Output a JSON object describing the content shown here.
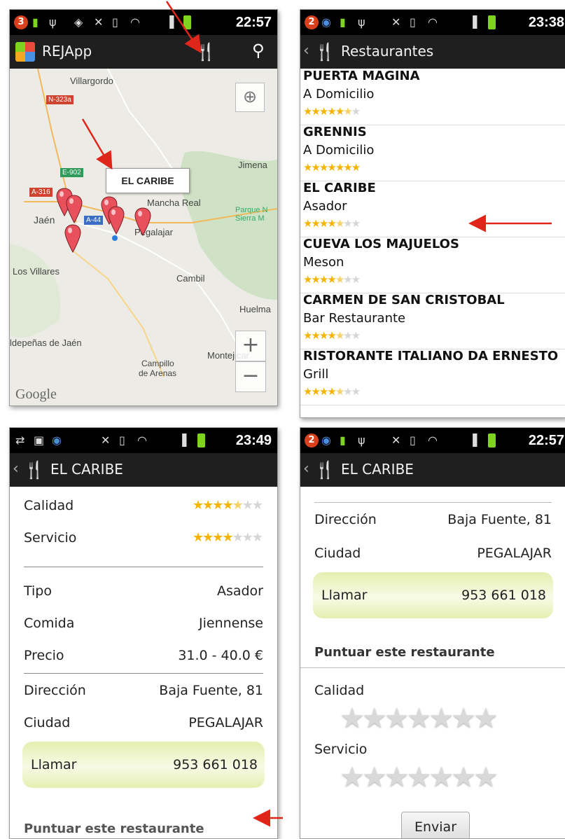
{
  "screen1": {
    "status_badge": "3",
    "time": "22:57",
    "app_title": "REJApp",
    "map": {
      "places": [
        "Villargordo",
        "Jimena",
        "Jaén",
        "Mancha Real",
        "Pegalajar",
        "Parque N",
        "Sierra M",
        "Los Villares",
        "Cambil",
        "Huelma",
        "ldepeñas de Jaén",
        "Campillo",
        "de Arenas",
        "Montejicar"
      ],
      "roads": [
        "N-323a",
        "E-902",
        "A-316",
        "A-44"
      ],
      "callout": "EL CARIBE",
      "attribution": "Google",
      "zoom_in": "+",
      "zoom_out": "−"
    }
  },
  "screen2": {
    "status_badge": "2",
    "time": "23:38",
    "title": "Restaurantes",
    "restaurants": [
      {
        "name": "PUERTA MAGINA",
        "type": "A Domicilio",
        "rating": 5.5
      },
      {
        "name": "GRENNIS",
        "type": "A Domicilio",
        "rating": 7
      },
      {
        "name": "EL CARIBE",
        "type": "Asador",
        "rating": 4.5
      },
      {
        "name": "CUEVA LOS MAJUELOS",
        "type": "Meson",
        "rating": 4.5
      },
      {
        "name": "CARMEN DE SAN CRISTOBAL",
        "type": "Bar Restaurante",
        "rating": 4.5
      },
      {
        "name": "RISTORANTE ITALIANO DA ERNESTO",
        "type": "Grill",
        "rating": 4.5
      }
    ]
  },
  "screen3": {
    "time": "23:49",
    "title": "EL CARIBE",
    "calidad_label": "Calidad",
    "servicio_label": "Servicio",
    "calidad_rating": 4.5,
    "servicio_rating": 4,
    "tipo_label": "Tipo",
    "tipo": "Asador",
    "comida_label": "Comida",
    "comida": "Jiennense",
    "precio_label": "Precio",
    "precio": "31.0 - 40.0 €",
    "direccion_label": "Dirección",
    "direccion": "Baja Fuente, 81",
    "ciudad_label": "Ciudad",
    "ciudad": "PEGALAJAR",
    "llamar_label": "Llamar",
    "telefono": "953 661 018",
    "puntuar": "Puntuar este restaurante"
  },
  "screen4": {
    "status_badge": "2",
    "time": "22:57",
    "title": "EL CARIBE",
    "direccion_label": "Dirección",
    "direccion": "Baja Fuente, 81",
    "ciudad_label": "Ciudad",
    "ciudad": "PEGALAJAR",
    "llamar_label": "Llamar",
    "telefono": "953 661 018",
    "puntuar": "Puntuar este restaurante",
    "calidad_label": "Calidad",
    "servicio_label": "Servicio",
    "enviar": "Enviar"
  },
  "colors": {
    "accent_arrow": "#e0261b",
    "star_on": "#f4b400",
    "call_box": "#e4efb0"
  }
}
